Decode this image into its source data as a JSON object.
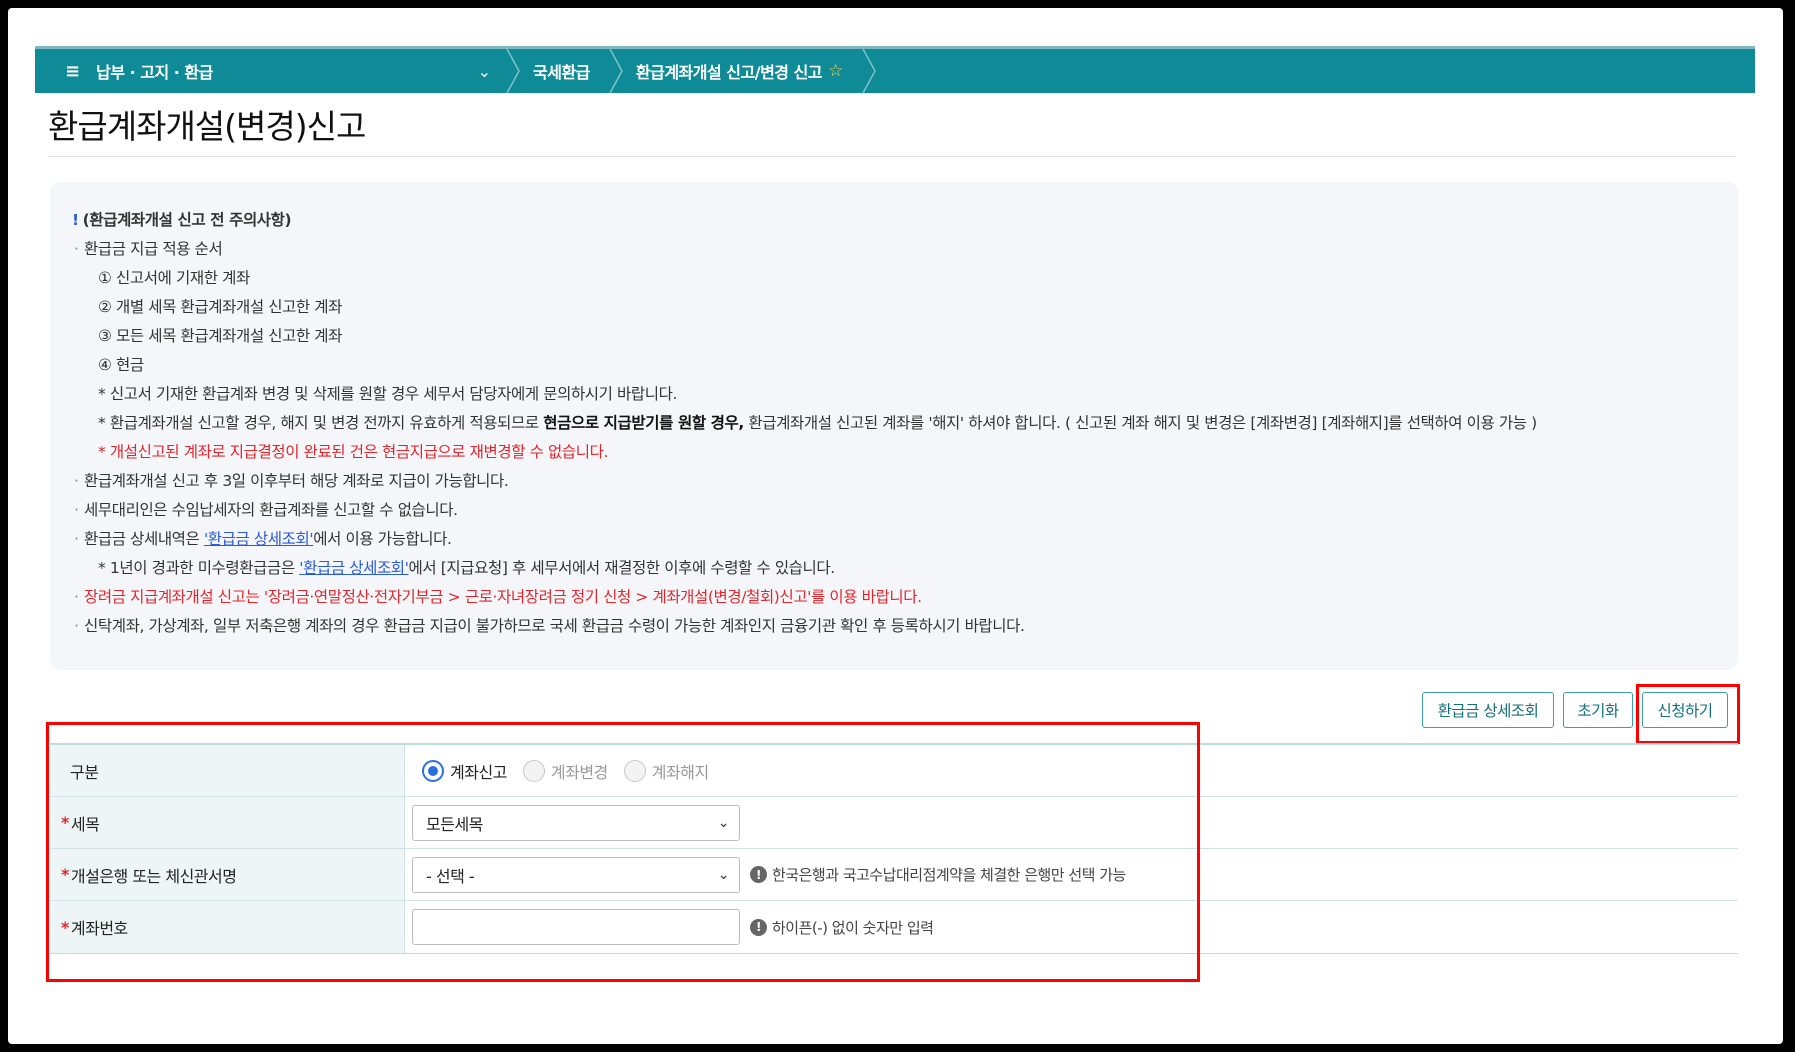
{
  "nav": {
    "menu_icon": "hamburger-icon",
    "menu_label": "납부 · 고지 · 환급",
    "crumbs": [
      "국세환급",
      "환급계좌개설 신고/변경 신고"
    ],
    "star_icon": "star-icon"
  },
  "page_title": "환급계좌개설(변경)신고",
  "notice": {
    "heading_mark": "!",
    "heading": "(환급계좌개설 신고 전 주의사항)",
    "order_title": "환급금 지급 적용 순서",
    "order_items": [
      "① 신고서에 기재한 계좌",
      "② 개별 세목 환급계좌개설 신고한 계좌",
      "③ 모든 세목 환급계좌개설 신고한 계좌",
      "④ 현금"
    ],
    "note1": "* 신고서 기재한 환급계좌 변경 및 삭제를 원할 경우 세무서 담당자에게 문의하시기 바랍니다.",
    "note2_a": "* 환급계좌개설 신고할 경우, 해지 및 변경 전까지 유효하게 적용되므로 ",
    "note2_b": "현금으로 지급받기를 원할 경우,",
    "note2_c": " 환급계좌개설 신고된 계좌를 '해지' 하셔야 합니다. ( 신고된 계좌 해지 및 변경은 [계좌변경] [계좌해지]를 선택하여 이용 가능 )",
    "note3": "* 개설신고된 계좌로 지급결정이 완료된 건은 현금지급으로 재변경할 수 없습니다.",
    "item_3days": "환급계좌개설 신고 후 3일 이후부터 해당 계좌로 지급이 가능합니다.",
    "item_agent": "세무대리인은 수임납세자의 환급계좌를 신고할 수 없습니다.",
    "item_detail_a": "환급금 상세내역은 ",
    "item_detail_link": "'환급금 상세조회'",
    "item_detail_b": "에서 이용 가능합니다.",
    "note4_a": "* 1년이 경과한 미수령환급금은 ",
    "note4_link": "'환급금 상세조회'",
    "note4_b": "에서 [지급요청] 후 세무서에서 재결정한 이후에 수령할 수 있습니다.",
    "item_red": "장려금 지급계좌개설 신고는 '장려금·연말정산·전자기부금 > 근로·자녀장려금 정기 신청 > 계좌개설(변경/철회)신고'를 이용 바랍니다.",
    "item_trust": "신탁계좌, 가상계좌, 일부 저축은행 계좌의 경우 환급금 지급이 불가하므로 국세 환급금 수령이 가능한 계좌인지 금융기관 확인 후 등록하시기 바랍니다."
  },
  "buttons": {
    "detail": "환급금 상세조회",
    "reset": "초기화",
    "apply": "신청하기"
  },
  "form": {
    "type_label": "구분",
    "type_options": [
      "계좌신고",
      "계좌변경",
      "계좌해지"
    ],
    "type_selected": "계좌신고",
    "req_mark": "*",
    "tax_label": "세목",
    "tax_value": "모든세목",
    "bank_label": "개설은행 또는 체신관서명",
    "bank_value": "- 선택 -",
    "bank_hint": "한국은행과 국고수납대리점계약을 체결한 은행만 선택 가능",
    "account_label": "계좌번호",
    "account_value": "",
    "account_hint": "하이픈(-) 없이 숫자만 입력",
    "hint_icon_glyph": "!"
  },
  "colors": {
    "nav_bg": "#0f8a97",
    "highlight_box": "#ff0000",
    "red_text": "#e2262b",
    "link": "#2b5bd7"
  }
}
